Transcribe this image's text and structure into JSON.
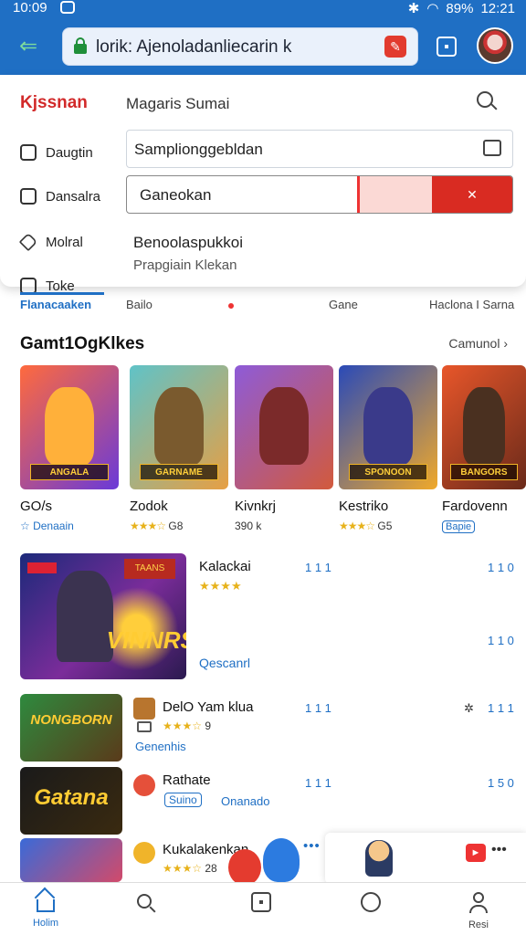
{
  "status_bar": {
    "time": "10:09",
    "battery": "89%",
    "clock": "12:21"
  },
  "browser": {
    "url": "lorik: Ajenoladanliecarin k"
  },
  "dropdown": {
    "brand": "Kjssnan",
    "title": "Magaris Sumai",
    "side_items": [
      {
        "label": "Daugtin"
      },
      {
        "label": "Dansalra"
      },
      {
        "label": "Molral"
      },
      {
        "label": "Toke"
      }
    ],
    "field1_value": "Samplionggebldan",
    "field2_value": "Ganeokan",
    "clear_label": "✕",
    "sub_title": "Benoolaspukkoi",
    "sub_text": "Prapgiain Klekan"
  },
  "filter_tabs": [
    {
      "label": "Flanacaaken"
    },
    {
      "label": "Bailo"
    },
    {
      "label": "Gane"
    },
    {
      "label": "Haclona I Sarna"
    }
  ],
  "section": {
    "title": "Gamt1OgKlkes",
    "link": "Camunol  ›"
  },
  "tiles": [
    {
      "name": "GO/s",
      "meta": "☆ Denaain",
      "banner": "ANGALA",
      "colors": [
        "#ff6a3d",
        "#6a3ad8"
      ]
    },
    {
      "name": "Zodok",
      "meta_stars": "★★★☆",
      "meta_count": "G8",
      "banner": "GARNAME",
      "colors": [
        "#5fc3c8",
        "#e79f43"
      ]
    },
    {
      "name": "Kivnkrj",
      "meta": "390 k",
      "banner": "",
      "colors": [
        "#8e5bd8",
        "#d25a3c"
      ]
    },
    {
      "name": "Kestriko",
      "meta_stars": "★★★☆",
      "meta_count": "G5",
      "banner": "SPONOON",
      "colors": [
        "#2a4ab8",
        "#f0a92a"
      ]
    },
    {
      "name": "Fardovenn",
      "meta_tag": "Bapie",
      "banner": "BANGORS",
      "colors": [
        "#e8562a",
        "#6a2a1a"
      ]
    }
  ],
  "featured": {
    "name": "Kalackai",
    "stars": "★★★★",
    "link": "Qescanrl",
    "logo": "VINNRS",
    "badge": "TAANS",
    "num1": "1 1 1",
    "num2": "1 1 0",
    "num3": "1 1 0"
  },
  "rows": [
    {
      "name": "DelO Yam klua",
      "stars": "★★★☆",
      "count": "9",
      "link": "Genenhis",
      "num": "1 1 1",
      "num2": "1 1 1",
      "extra": "✲",
      "logo": "NONGBORN"
    },
    {
      "name": "Rathate",
      "tag": "Suino",
      "link": "Onanado",
      "num": "1 1 1",
      "num2": "1 5 0",
      "logo": "Gatana"
    },
    {
      "name": "Kukalakenkan",
      "stars": "★★★☆",
      "count": "28",
      "dots": "•••",
      "logo": ""
    }
  ],
  "float_card": {
    "badge": "►",
    "more": "•••"
  },
  "bottom_nav": [
    {
      "label": "Holim"
    },
    {
      "label": ""
    },
    {
      "label": ""
    },
    {
      "label": ""
    },
    {
      "label": "Resi"
    }
  ]
}
